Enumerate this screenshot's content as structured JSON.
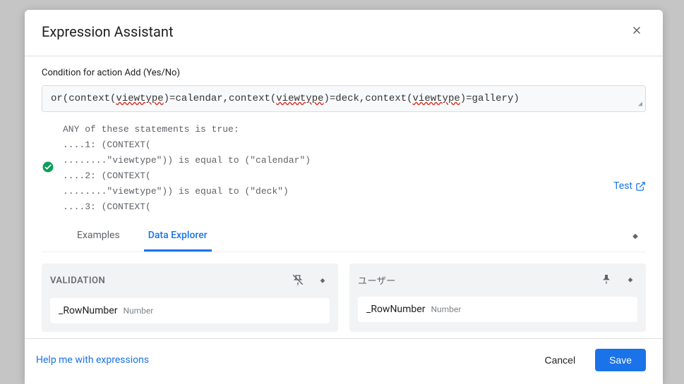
{
  "header": {
    "title": "Expression Assistant"
  },
  "condition_label": "Condition for action Add (Yes/No)",
  "expression": {
    "pre1": "or(context(",
    "u1": "viewtype",
    "mid1": ")=calendar,context(",
    "u2": "viewtype",
    "mid2": ")=deck,context(",
    "u3": "viewtype",
    "post": ")=gallery)"
  },
  "validation_lines": "ANY of these statements is true:\n....1: (CONTEXT(\n........\"viewtype\")) is equal to (\"calendar\")\n....2: (CONTEXT(\n........\"viewtype\")) is equal to (\"deck\")\n....3: (CONTEXT(",
  "test_label": "Test",
  "tabs": {
    "examples": "Examples",
    "data_explorer": "Data Explorer"
  },
  "panels": [
    {
      "title": "VALIDATION",
      "pinned": false,
      "fields": [
        {
          "name": "_RowNumber",
          "type": "Number"
        }
      ]
    },
    {
      "title": "ユーザー",
      "pinned": true,
      "fields": [
        {
          "name": "_RowNumber",
          "type": "Number"
        }
      ]
    }
  ],
  "footer": {
    "help": "Help me with expressions",
    "cancel": "Cancel",
    "save": "Save"
  }
}
